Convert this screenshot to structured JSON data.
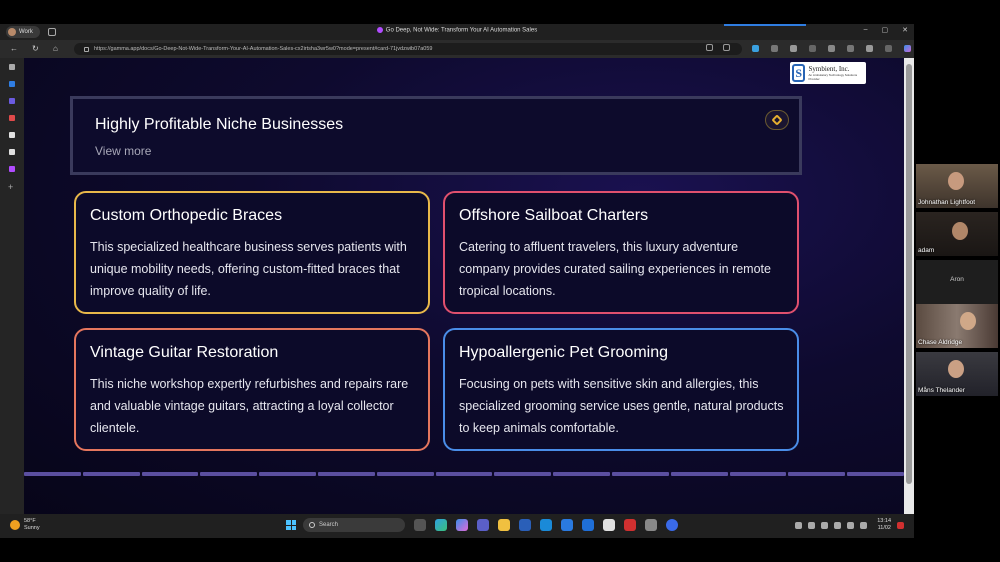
{
  "browser": {
    "profile_label": "Work",
    "window_title": "Go Deep, Not Wide: Transform Your AI Automation Sales",
    "url": "https://gamma.app/docs/Go-Deep-Not-Wide-Transform-Your-AI-Automation-Sales-cx2irtsha3wr5w0?mode=present#card-71jvdzwib07a059",
    "win_minimize": "–",
    "win_maximize": "▢",
    "win_close": "✕",
    "nav_back": "←",
    "nav_reload": "↻",
    "nav_home": "⌂"
  },
  "logo": {
    "mark": "S",
    "name": "Symbient, Inc.",
    "tagline": "An Ambulatory Technology Solutions Provider"
  },
  "banner": {
    "title": "Highly Profitable Niche Businesses",
    "subtitle": "View more"
  },
  "cards": [
    {
      "title": "Custom Orthopedic Braces",
      "body": "This specialized healthcare business serves patients with unique mobility needs, offering custom-fitted braces that improve quality of life.",
      "border": "#e8b84a"
    },
    {
      "title": "Offshore Sailboat Charters",
      "body": "Catering to affluent travelers, this luxury adventure company provides curated sailing experiences in remote tropical locations.",
      "border": "#e0506e"
    },
    {
      "title": "Vintage Guitar Restoration",
      "body": "This niche workshop expertly refurbishes and repairs rare and valuable vintage guitars, attracting a loyal collector clientele.",
      "border": "#e5765e"
    },
    {
      "title": "Hypoallergenic Pet Grooming",
      "body": "Focusing on pets with sensitive skin and allergies, this specialized grooming service uses gentle, natural products to keep animals comfortable.",
      "border": "#4a8de8"
    }
  ],
  "participants": [
    {
      "name": "Johnathan Lightfoot"
    },
    {
      "name": "adam"
    },
    {
      "name": "Aron"
    },
    {
      "name": "Chase Aldridge"
    },
    {
      "name": "Måns Thelander"
    }
  ],
  "taskbar": {
    "temperature": "58°F",
    "weather": "Sunny",
    "search_placeholder": "Search",
    "time": "13:14",
    "date": "11/02"
  },
  "colors": {
    "page_bg": "#0e0a2e",
    "banner_border": "#3a3a5c",
    "accent": "#e6b030"
  }
}
